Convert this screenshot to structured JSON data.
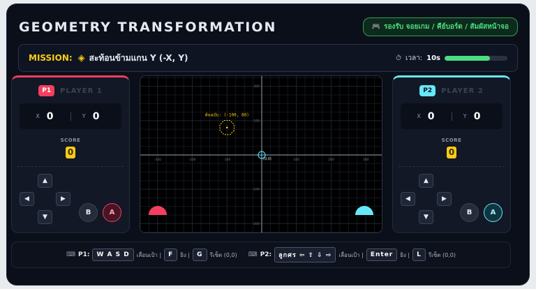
{
  "header": {
    "title": "GEOMETRY TRANSFORMATION",
    "support_icon": "gamepad-icon",
    "support_text": "รองรับ จอยเกม / คีย์บอร์ด / สัมผัสหน้าจอ"
  },
  "mission": {
    "label": "MISSION:",
    "icon": "target-icon",
    "text": "สะท้อนข้ามแกน Y (-X, Y)",
    "timer_label": "เวลา:",
    "timer_value": "10s",
    "timer_progress": 0.72
  },
  "players": [
    {
      "badge": "P1",
      "name": "PLAYER 1",
      "x_label": "X",
      "x": "0",
      "y_label": "Y",
      "y": "0",
      "score_label": "SCORE",
      "score": "0",
      "btn_b": "B",
      "btn_a": "A",
      "color": "#f43f5e"
    },
    {
      "badge": "P2",
      "name": "PLAYER 2",
      "x_label": "X",
      "x": "0",
      "y_label": "Y",
      "y": "0",
      "score_label": "SCORE",
      "score": "0",
      "btn_b": "B",
      "btn_a": "A",
      "color": "#67e8f9"
    }
  ],
  "board": {
    "x_ticks": [
      "-300",
      "-200",
      "-100",
      "100",
      "200",
      "300"
    ],
    "y_ticks": [
      "200",
      "100",
      "-100",
      "-200"
    ],
    "origin_label": "(0,0)",
    "target_label": "ต้นฉบับ: (-100, 80)",
    "target": {
      "x": -100,
      "y": 80
    },
    "x_range": [
      -350,
      350
    ],
    "y_range": [
      -230,
      230
    ]
  },
  "footer": {
    "kbd_icon": "keyboard-icon",
    "p1_label": "P1:",
    "p1_move_key": "W A S D",
    "p1_move_text": "เลื่อนเป้า |",
    "p1_fire_key": "F",
    "p1_fire_text": "ยิง |",
    "p1_reset_key": "G",
    "p1_reset_text": "รีเซ็ต (0,0)",
    "p2_label": "P2:",
    "p2_move_key": "ลูกศร ⇦ ⇧ ⇩ ⇨",
    "p2_move_text": "เลื่อนเป้า |",
    "p2_fire_key": "Enter",
    "p2_fire_text": "ยิง |",
    "p2_reset_key": "L",
    "p2_reset_text": "รีเซ็ต (0,0)"
  }
}
